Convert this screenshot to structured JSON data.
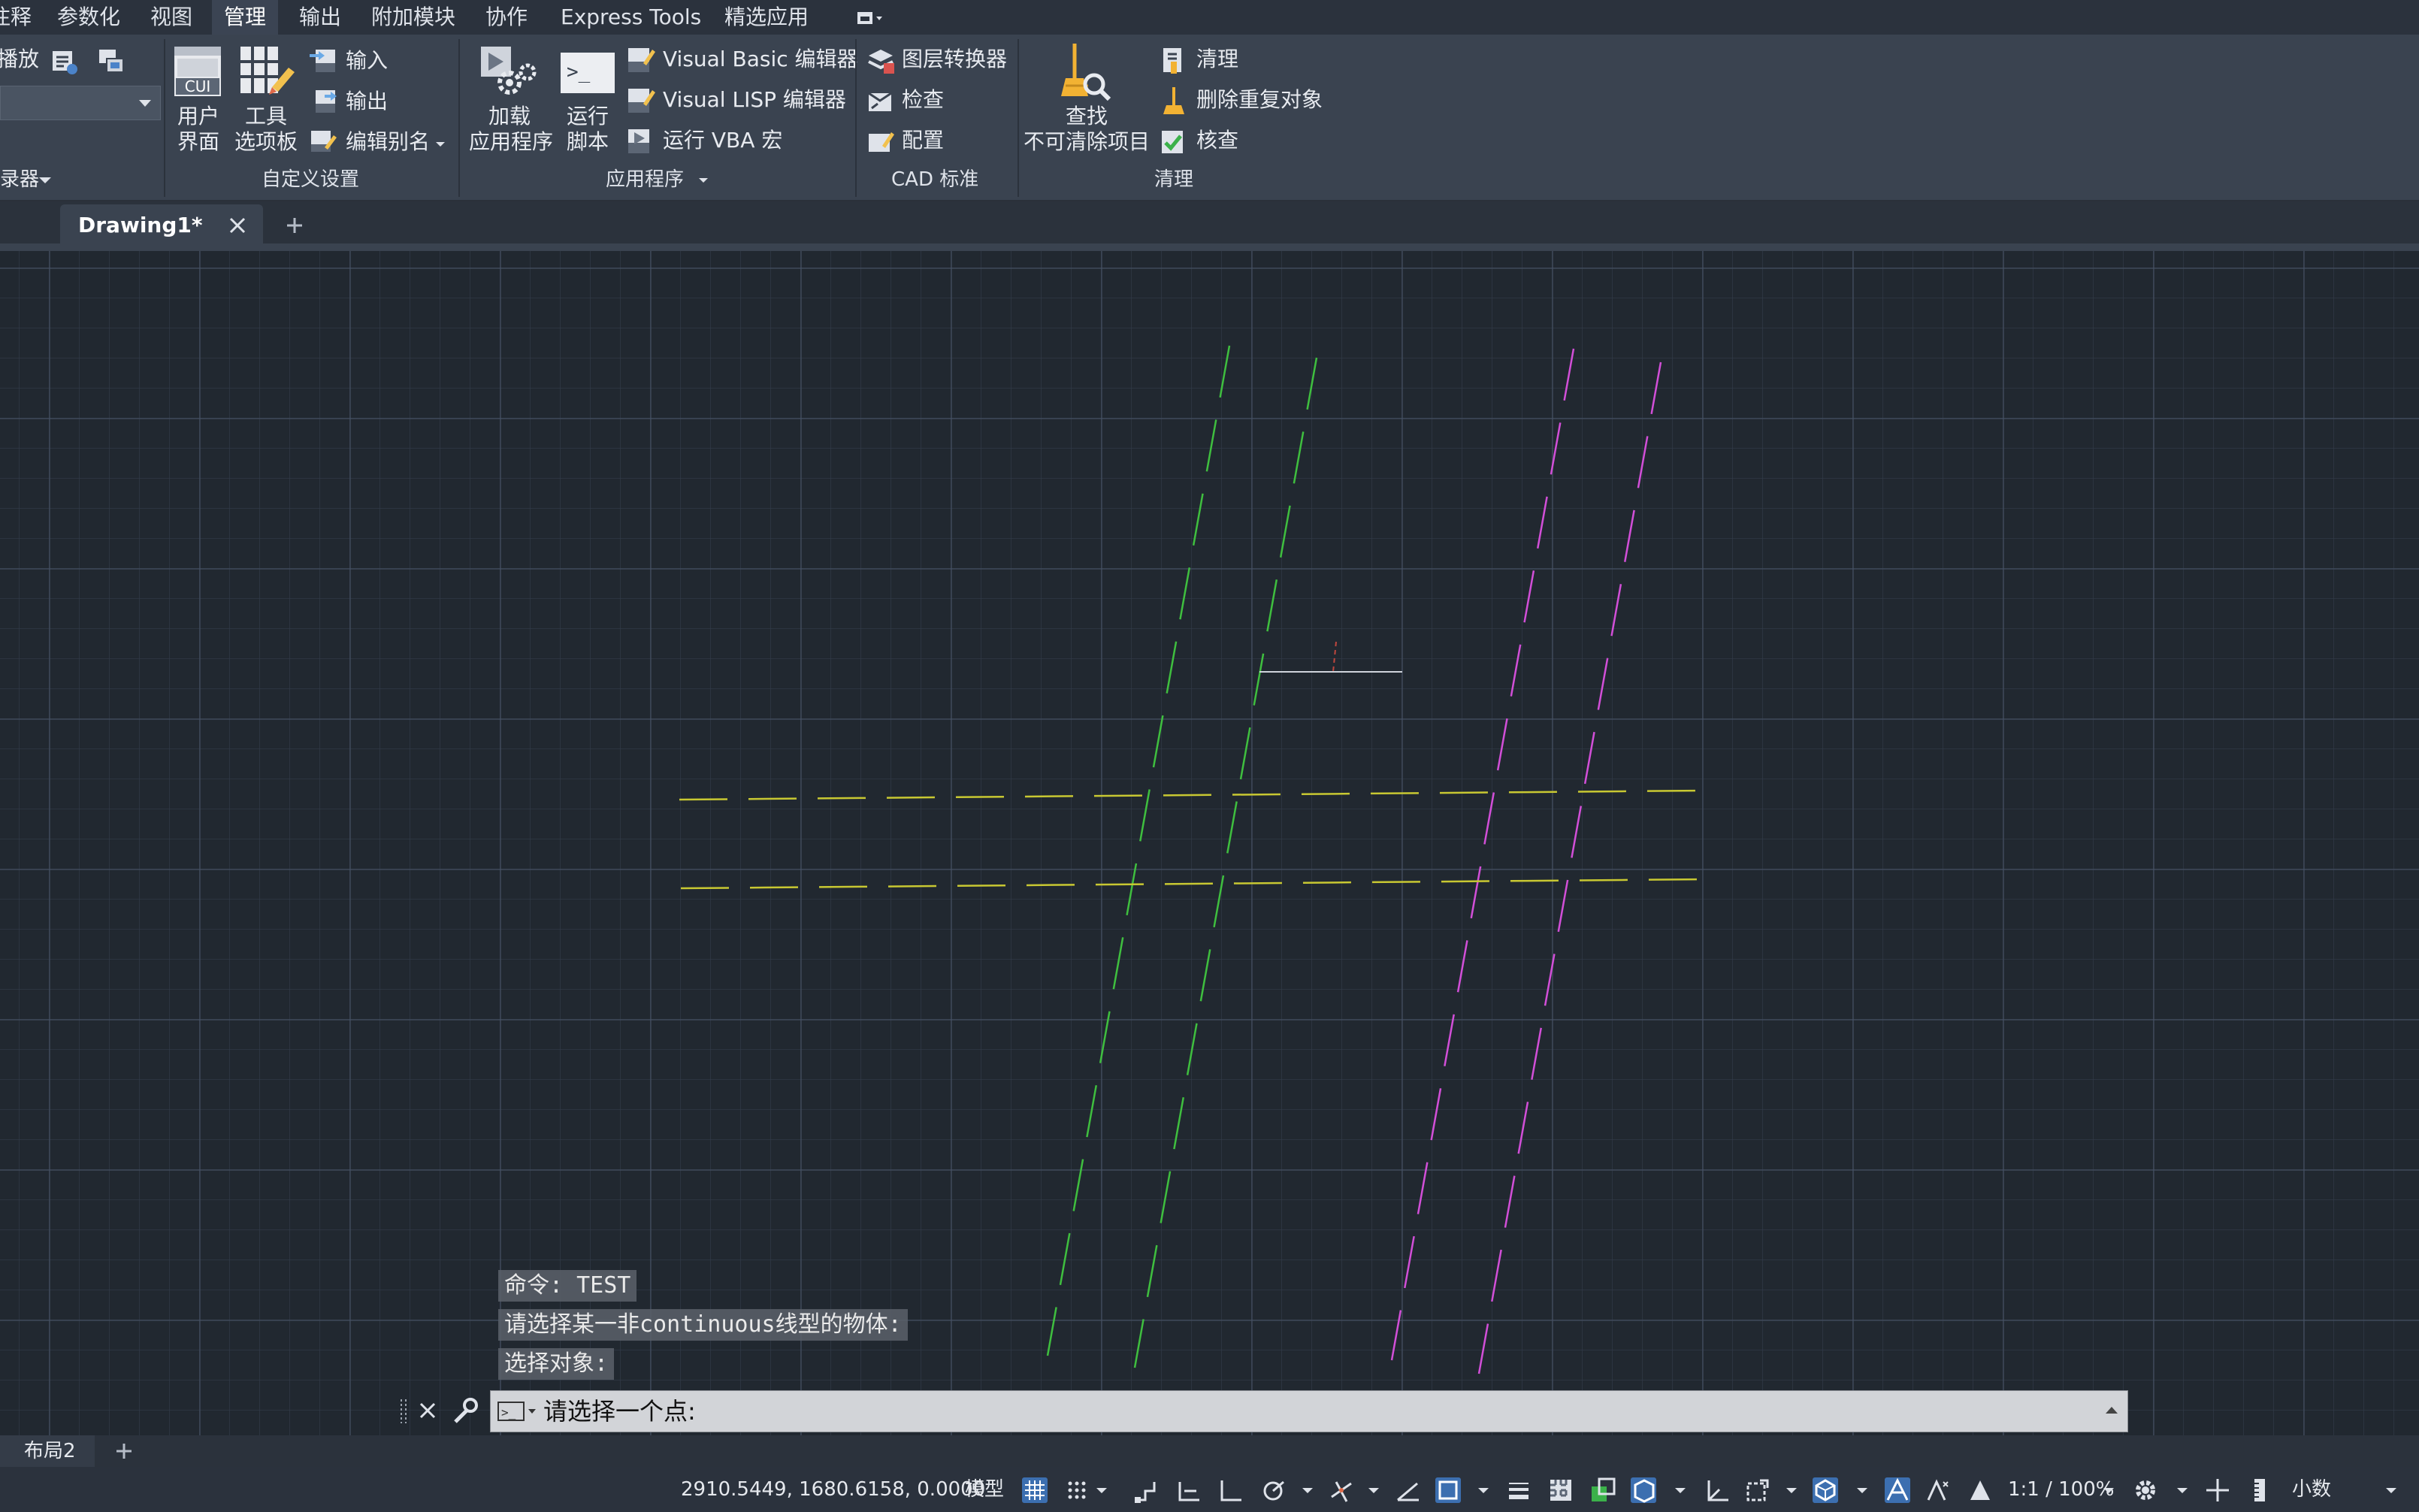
{
  "menu": {
    "items": [
      "注释",
      "参数化",
      "视图",
      "管理",
      "输出",
      "附加模块",
      "协作",
      "Express Tools",
      "精选应用"
    ],
    "active": "管理"
  },
  "ribbon": {
    "partial_panel": {
      "playback_label": "播放",
      "label": "记录器"
    },
    "customization": {
      "user_interface_l1": "用户",
      "user_interface_l2": "界面",
      "tool_palettes_l1": "工具",
      "tool_palettes_l2": "选项板",
      "import": "输入",
      "export": "输出",
      "edit_aliases": "编辑别名",
      "label": "自定义设置"
    },
    "applications": {
      "load_app_l1": "加载",
      "load_app_l2": "应用程序",
      "run_script_l1": "运行",
      "run_script_l2": "脚本",
      "vb_editor": "Visual Basic 编辑器",
      "lisp_editor": "Visual LISP 编辑器",
      "run_vba": "运行 VBA 宏",
      "label": "应用程序"
    },
    "cad_standards": {
      "layer_translator": "图层转换器",
      "check": "检查",
      "configure": "配置",
      "label": "CAD 标准"
    },
    "cleanup": {
      "find_l1": "查找",
      "find_l2": "不可清除项目",
      "purge": "清理",
      "overkill": "删除重复对象",
      "audit": "核查",
      "label": "清理"
    }
  },
  "doc_tabs": {
    "active": "Drawing1*"
  },
  "command": {
    "history": [
      "命令:  TEST",
      " 请选择某一非continuous线型的物体:",
      "选择对象:"
    ],
    "prompt": "请选择一个点:"
  },
  "layout_tabs": {
    "current": "布局2"
  },
  "status": {
    "coordinates": "2910.5449, 1680.6158, 0.0000",
    "space": "模型",
    "scale": "1:1 / 100%",
    "units": "小数"
  },
  "colors": {
    "green_lines": "#3fbf3f",
    "magenta_lines": "#d24fd8",
    "yellow_lines": "#c8c832",
    "canvas_bg": "#212830",
    "ribbon_bg": "#3a4350"
  }
}
